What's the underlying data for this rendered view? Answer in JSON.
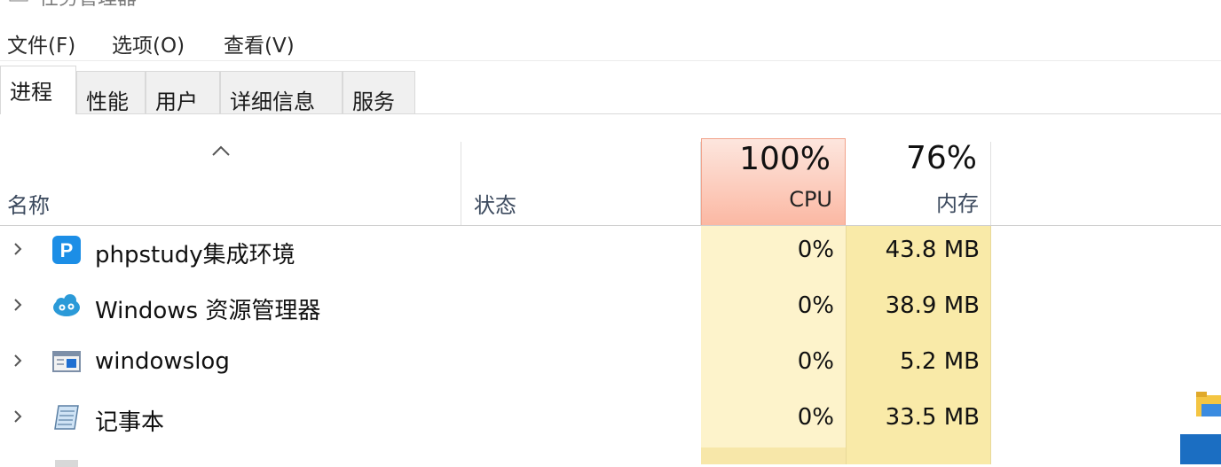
{
  "window": {
    "title": "任务管理器"
  },
  "menu": [
    {
      "label": "文件(F)"
    },
    {
      "label": "选项(O)"
    },
    {
      "label": "查看(V)"
    }
  ],
  "tabs": [
    {
      "label": "进程",
      "active": true
    },
    {
      "label": "性能"
    },
    {
      "label": "用户"
    },
    {
      "label": "详细信息"
    },
    {
      "label": "服务"
    }
  ],
  "columns": {
    "name": "名称",
    "status": "状态",
    "cpu": {
      "percent": "100%",
      "label": "CPU"
    },
    "memory": {
      "percent": "76%",
      "label": "内存"
    }
  },
  "processes": [
    {
      "name": "phpstudy集成环境",
      "icon": "phpstudy-icon",
      "cpu": "0%",
      "memory": "43.8 MB"
    },
    {
      "name": "Windows 资源管理器",
      "icon": "explorer-gear-icon",
      "cpu": "0%",
      "memory": "38.9 MB"
    },
    {
      "name": "windowslog",
      "icon": "window-app-icon",
      "cpu": "0%",
      "memory": "5.2 MB"
    },
    {
      "name": "记事本",
      "icon": "notepad-icon",
      "cpu": "0%",
      "memory": "33.5 MB"
    }
  ],
  "colors": {
    "cpu_header": "#fbb8a3",
    "cpu_column": "#fdf3cb",
    "memory_column": "#f9eaa8",
    "accent": "#1b6ec2"
  }
}
